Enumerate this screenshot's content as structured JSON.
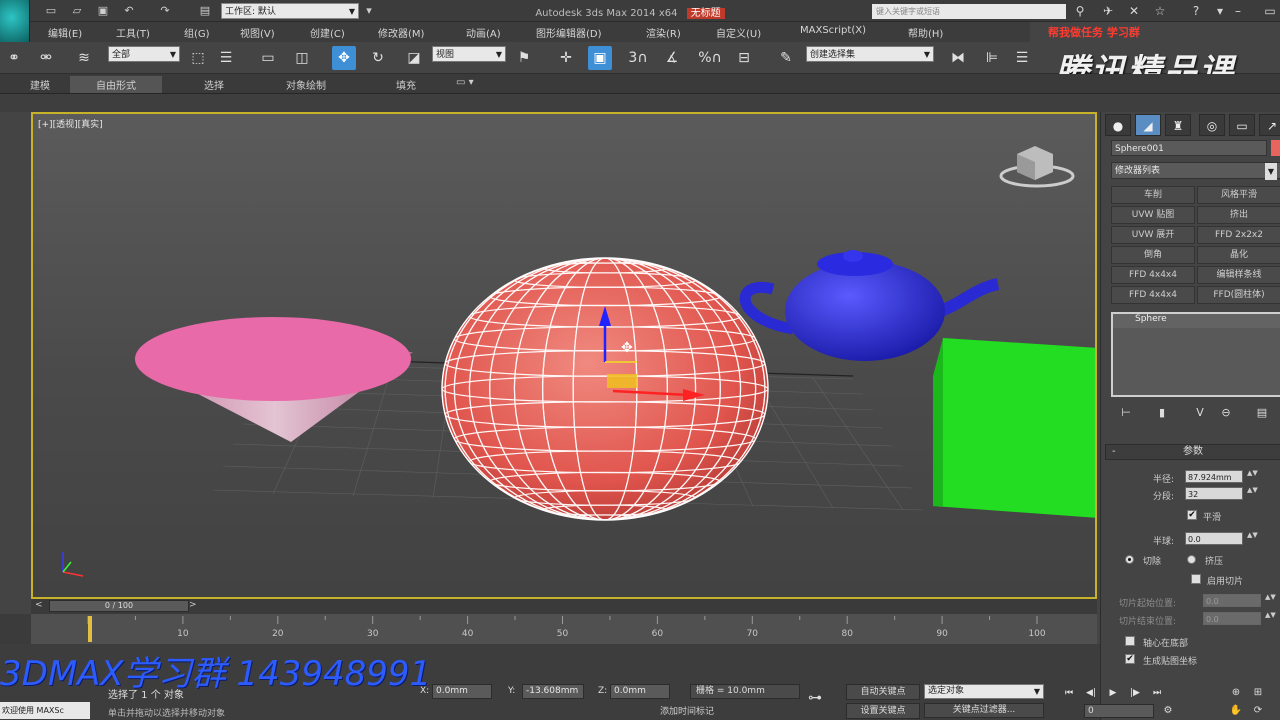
{
  "titlebar": {
    "workspace": "工作区: 默认",
    "app_title": "Autodesk 3ds Max  2014 x64",
    "document": "无标题",
    "search_placeholder": "键入关键字或短语"
  },
  "menu": {
    "items": [
      "编辑(E)",
      "工具(T)",
      "组(G)",
      "视图(V)",
      "创建(C)",
      "修改器(M)",
      "动画(A)",
      "图形编辑器(D)",
      "渲染(R)",
      "自定义(U)",
      "MAXScript(X)",
      "帮助(H)"
    ]
  },
  "group_ad": "帮我做任务 学习群",
  "toolbar": {
    "selection_filter": "全部",
    "reference_coord": "视图",
    "named_selection": "创建选择集",
    "snap_3": "3",
    "angle_snap": "%"
  },
  "watermark": "腾讯精品课",
  "ribbon": {
    "tabs": [
      "建模",
      "自由形式",
      "选择",
      "对象绘制",
      "填充"
    ],
    "active_tab": "自由形式"
  },
  "viewport": {
    "label": "[+][透视][真实]",
    "cone_color": "#e86aa8",
    "sphere_color": "#e8645f",
    "teapot_color": "#2323d8",
    "box_color": "#22dd22",
    "border_color": "#c8b22a"
  },
  "command_panel": {
    "object_name": "Sphere001",
    "object_color": "#e8645f",
    "modifier_list": "修改器列表",
    "modifier_buttons": [
      [
        "车削",
        "风格平滑"
      ],
      [
        "UVW 贴图",
        "挤出"
      ],
      [
        "UVW 展开",
        "FFD 2x2x2"
      ],
      [
        "倒角",
        "晶化"
      ],
      [
        "FFD 4x4x4",
        "编辑样条线"
      ],
      [
        "FFD 4x4x4",
        "FFD(圆柱体)"
      ]
    ],
    "stack_item": "Sphere",
    "params": {
      "title": "参数",
      "radius_label": "半径:",
      "radius_value": "87.924mm",
      "segments_label": "分段:",
      "segments_value": "32",
      "smooth_label": "平滑",
      "smooth_checked": true,
      "hemisphere_label": "半球:",
      "hemisphere_value": "0.0",
      "chop_label": "切除",
      "squash_label": "挤压",
      "slice_on_label": "启用切片",
      "slice_from_label": "切片起始位置:",
      "slice_from_value": "0.0",
      "slice_to_label": "切片结束位置:",
      "slice_to_value": "0.0",
      "base_to_pivot_label": "轴心在底部",
      "gen_mapping_label": "生成贴图坐标"
    }
  },
  "timeline": {
    "slider_label": "0 / 100",
    "ticks": [
      0,
      10,
      20,
      30,
      40,
      50,
      60,
      70,
      80,
      90,
      100
    ]
  },
  "status": {
    "qq_ad": "3DMAX学习群 143948991",
    "maxscript_label": "欢迎使用 MAXSc",
    "selection": "选择了 1 个 对象",
    "prompt": "单击并拖动以选择并移动对象",
    "x_label": "X:",
    "x_value": "0.0mm",
    "y_label": "Y:",
    "y_value": "-13.608mm",
    "z_label": "Z:",
    "z_value": "0.0mm",
    "grid": "栅格 = 10.0mm",
    "add_time_tag": "添加时间标记",
    "auto_key": "自动关键点",
    "set_key": "设置关键点",
    "key_filter_select": "选定对象",
    "key_filters": "关键点过滤器...",
    "frame_value": "0"
  }
}
